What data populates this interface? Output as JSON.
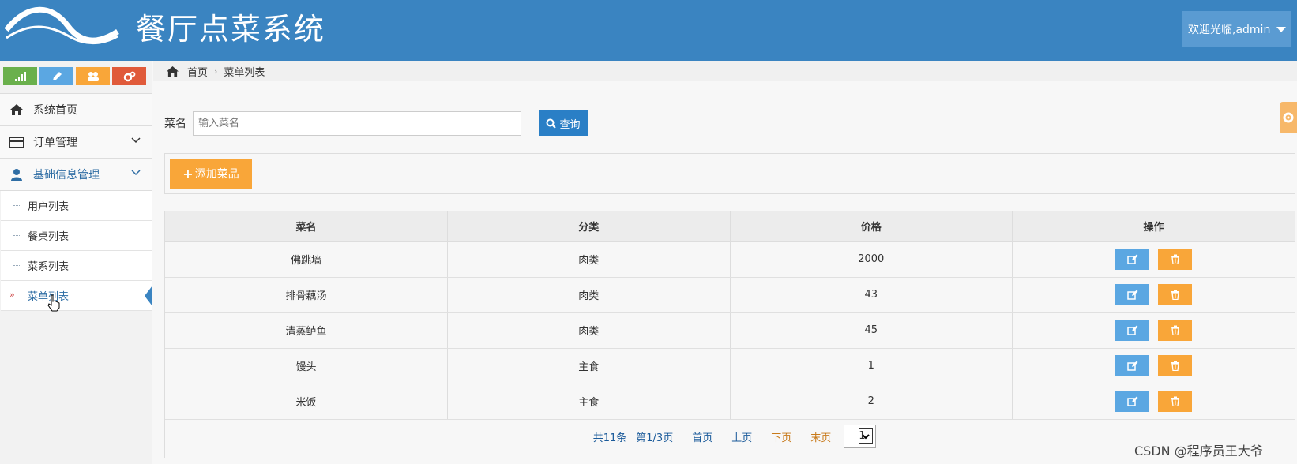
{
  "header": {
    "title": "餐厅点菜系统",
    "user_greeting": "欢迎光临,admin",
    "brand_color": "#3a84c1"
  },
  "sidebar": {
    "shortcuts": [
      {
        "icon": "signal-icon",
        "color": "#6ab04c"
      },
      {
        "icon": "pencil-icon",
        "color": "#5ba7e2"
      },
      {
        "icon": "users-icon",
        "color": "#f9a639"
      },
      {
        "icon": "cogs-icon",
        "color": "#e05a3a"
      }
    ],
    "items": [
      {
        "label": "系统首页",
        "icon": "home-icon"
      },
      {
        "label": "订单管理",
        "icon": "card-icon"
      },
      {
        "label": "基础信息管理",
        "icon": "user-icon"
      }
    ],
    "sub_items": [
      {
        "label": "用户列表"
      },
      {
        "label": "餐桌列表"
      },
      {
        "label": "菜系列表"
      },
      {
        "label": "菜单列表"
      }
    ]
  },
  "breadcrumb": {
    "home": "首页",
    "current": "菜单列表"
  },
  "search": {
    "label": "菜名",
    "placeholder": "输入菜名",
    "button": "查询"
  },
  "toolbar": {
    "add_label": "添加菜品"
  },
  "table": {
    "headers": [
      "菜名",
      "分类",
      "价格",
      "操作"
    ],
    "rows": [
      {
        "name": "佛跳墙",
        "category": "肉类",
        "price": "2000"
      },
      {
        "name": "排骨藕汤",
        "category": "肉类",
        "price": "43"
      },
      {
        "name": "清蒸鲈鱼",
        "category": "肉类",
        "price": "45"
      },
      {
        "name": "馒头",
        "category": "主食",
        "price": "1"
      },
      {
        "name": "米饭",
        "category": "主食",
        "price": "2"
      }
    ]
  },
  "pager": {
    "total": "共11条",
    "page_info": "第1/3页",
    "first": "首页",
    "prev": "上页",
    "next": "下页",
    "last": "末页",
    "current_page": "1"
  },
  "watermark": "CSDN @程序员王大爷"
}
